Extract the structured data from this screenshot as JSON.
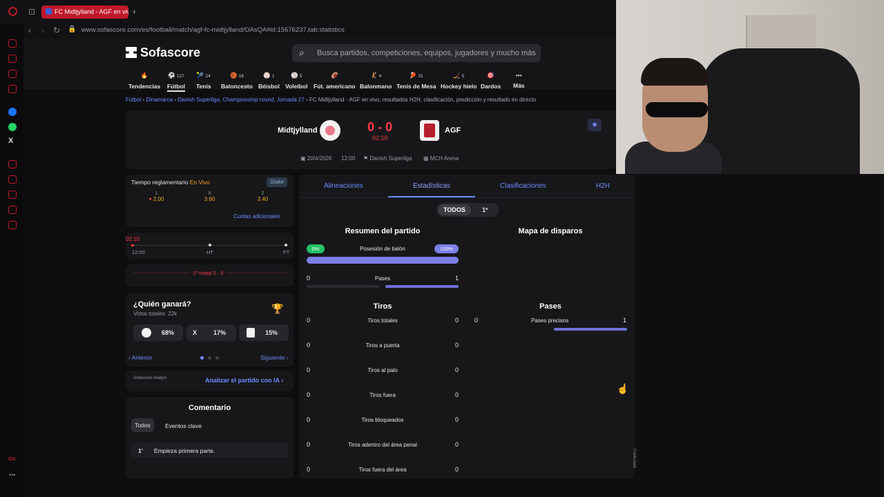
{
  "browser": {
    "tab_title": "FC Midtjylland - AGF en vivo",
    "url": "www.sofascore.com/es/football/match/agf-fc-midtjylland/OAsQA#id:15676237,tab:statistics"
  },
  "site": {
    "logo": "Sofascore",
    "search_placeholder": "Busca partidos, competiciones, equipos, jugadores y mucho más"
  },
  "sports_nav": [
    {
      "label": "Tendencias",
      "count": ""
    },
    {
      "label": "Fútbol",
      "count": "127"
    },
    {
      "label": "Tenis",
      "count": "24"
    },
    {
      "label": "Baloncesto",
      "count": "18"
    },
    {
      "label": "Béisbol",
      "count": "1"
    },
    {
      "label": "Voleibol",
      "count": "5"
    },
    {
      "label": "Fút. americano",
      "count": ""
    },
    {
      "label": "Balonmano",
      "count": "4"
    },
    {
      "label": "Tenis de Mesa",
      "count": "31"
    },
    {
      "label": "Hockey hielo",
      "count": "5"
    },
    {
      "label": "Dardos",
      "count": ""
    },
    {
      "label": "Más",
      "count": ""
    }
  ],
  "breadcrumb": {
    "items": [
      "Fútbol",
      "Dinamarca",
      "Danish Superliga, Championship round, Jornada 27"
    ],
    "current": "FC Midtjylland - AGF en vivo, resultados H2H, clasificación, predicción y resultado en directo"
  },
  "match": {
    "home": "Midtjylland",
    "away": "AGF",
    "score": "0 - 0",
    "minute": "02:10",
    "date": "20/4/2026",
    "time": "12:00",
    "competition": "Danish Superliga",
    "venue": "MCH Arena"
  },
  "odds": {
    "header": "Tiempo reglamentario",
    "live_tag": "En Vivo",
    "cols": [
      {
        "label": "1",
        "value": "2.00"
      },
      {
        "label": "X",
        "value": "3.60"
      },
      {
        "label": "2",
        "value": "3.40"
      }
    ],
    "more": "Cuotas adicionales"
  },
  "timeline": {
    "minute": "02:10",
    "start": "12:00",
    "ht": "HT",
    "ft": "FT",
    "period": "1ª mitad 0 - 0"
  },
  "vote": {
    "title": "¿Quién ganará?",
    "total": "Votos totales: 22k",
    "home_pct": "68%",
    "draw_label": "X",
    "draw_pct": "17%",
    "away_pct": "15%",
    "prev": "Anterior",
    "next": "Siguiente"
  },
  "ai": {
    "brand": "Sofascore Analyst",
    "cta": "Analizar el partido con IA"
  },
  "commentary": {
    "title": "Comentario",
    "tab_all": "Todos",
    "tab_key": "Eventos clave",
    "entries": [
      {
        "min": "1'",
        "text": "Empieza primera parte."
      }
    ]
  },
  "stats_tabs": [
    "Alineaciones",
    "Estadísticas",
    "Clasificaciones",
    "H2H"
  ],
  "period_toggle": {
    "all": "TODOS",
    "first": "1º"
  },
  "summary": {
    "title": "Resumen del partido",
    "possession": {
      "label": "Posesión de balón",
      "home": "0%",
      "away": "100%",
      "away_fraction": 1.0
    },
    "passes": {
      "label": "Pases",
      "home": "0",
      "away": "1"
    }
  },
  "shot_map_title": "Mapa de disparos",
  "shots": {
    "title": "Tiros",
    "rows": [
      {
        "label": "Tiros totales",
        "home": "0",
        "away": "0"
      },
      {
        "label": "Tiros a puerta",
        "home": "0",
        "away": "0"
      },
      {
        "label": "Tiros al palo",
        "home": "0",
        "away": "0"
      },
      {
        "label": "Tiros fuera",
        "home": "0",
        "away": "0"
      },
      {
        "label": "Tiros bloqueados",
        "home": "0",
        "away": "0"
      },
      {
        "label": "Tiros adentro del área penal",
        "home": "0",
        "away": "0"
      },
      {
        "label": "Tiros fuera del área",
        "home": "0",
        "away": "0"
      }
    ]
  },
  "passes_section": {
    "title": "Pases",
    "accurate": {
      "label": "Pases precisos",
      "home": "0",
      "away": "1"
    }
  },
  "ad_label": "Publicidad"
}
